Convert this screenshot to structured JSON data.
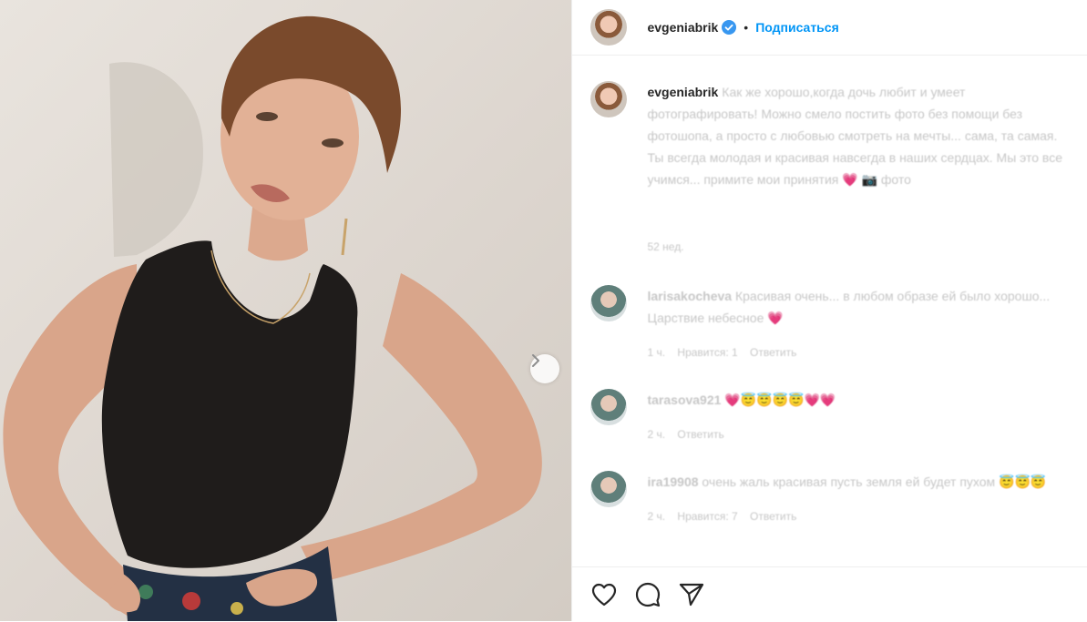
{
  "header": {
    "username": "evgeniabrik",
    "separator": "•",
    "follow_label": "Подписаться"
  },
  "caption": {
    "username": "evgeniabrik",
    "text": "Как же хорошо,когда дочь любит и умеет фотографировать! Можно смело постить фото без помощи без фотошопа, а просто с любовью смотреть на мечты... сама, та самая. Ты всегда молодая и красивая навсегда в наших сердцах. Мы это все учимся... примите мои принятия 💗 📷 фото",
    "time": "52 нед."
  },
  "comments": [
    {
      "username": "larisakocheva",
      "text": "Красивая очень... в любом образе ей было хорошо... Царствие небесное 💗",
      "time": "1 ч.",
      "likes": "Нравится: 1",
      "reply": "Ответить"
    },
    {
      "username": "tarasova921",
      "text": "💗😇😇😇😇💗💗",
      "time": "2 ч.",
      "likes": "",
      "reply": "Ответить"
    },
    {
      "username": "ira19908",
      "text": "очень жаль красивая пусть земля ей будет пухом 😇😇😇",
      "time": "2 ч.",
      "likes": "Нравится: 7",
      "reply": "Ответить"
    }
  ],
  "icons": [
    "verified-badge-icon",
    "chevron-right-icon",
    "heart-icon",
    "comment-icon",
    "share-icon"
  ],
  "colors": {
    "link_blue": "#0095f6",
    "verified_blue": "#3897f0",
    "text": "#262626",
    "muted": "#c7c7c7"
  }
}
